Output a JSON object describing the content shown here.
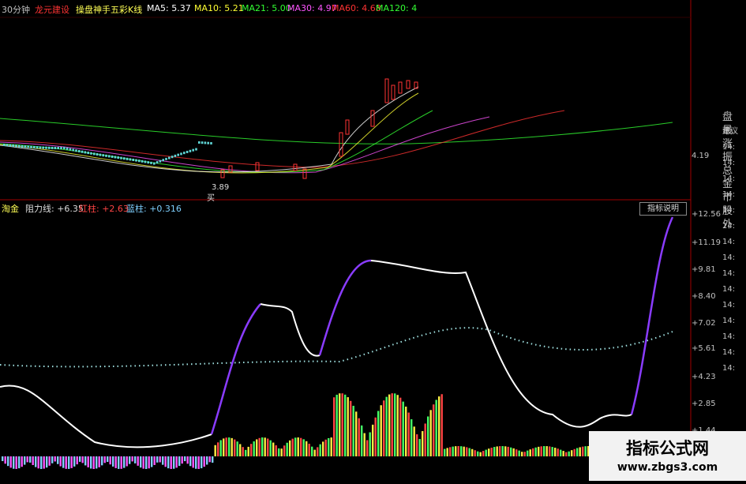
{
  "header": {
    "period": "30分钟",
    "stock_name": "龙元建设",
    "indicator_name": "操盘神手五彩K线",
    "ma5": "MA5: 5.37",
    "ma10": "MA10: 5.21",
    "ma21": "MA21: 5.00",
    "ma30": "MA30: 4.97",
    "ma60": "MA60: 4.68",
    "ma120": "MA120: 4"
  },
  "price_axis": {
    "label": "4.19"
  },
  "price_marker": {
    "low_label": "3.89",
    "buy_label": "买"
  },
  "indicator": {
    "name": "淘金",
    "resistance": "阻力线: +6.35",
    "red_bar": "红柱: +2.63",
    "blue_bar": "蓝柱: +0.316",
    "explain_button": "指标说明"
  },
  "indicator_axis": [
    "12.56",
    "11.19",
    "9.81",
    "8.40",
    "7.02",
    "5.61",
    "4.23",
    "2.85",
    "1.44"
  ],
  "sidebar": {
    "items": [
      "盘",
      "最",
      "涨",
      "振",
      "总",
      "金",
      "市",
      "股",
      "外"
    ],
    "sub_label": "建议",
    "times": [
      "14:",
      "14:",
      "14:",
      "14:",
      "14:",
      "14:",
      "14:",
      "14:",
      "14:",
      "14:",
      "14:",
      "14:",
      "14:",
      "14:",
      "14:"
    ]
  },
  "watermark": {
    "title": "指标公式网",
    "url": "www.zbgs3.com"
  },
  "colors": {
    "stock_name": "#ff3333",
    "indicator_name": "#ffff55",
    "ma5": "#ffffff",
    "ma10": "#ffff33",
    "ma21": "#33ff33",
    "ma30": "#ff55ff",
    "ma60": "#ff3333",
    "ma120": "#33ff33",
    "red_bar": "#ff4444",
    "blue_bar": "#7fd0ff",
    "purple_line": "#8a3cff",
    "white_line": "#ffffff"
  }
}
